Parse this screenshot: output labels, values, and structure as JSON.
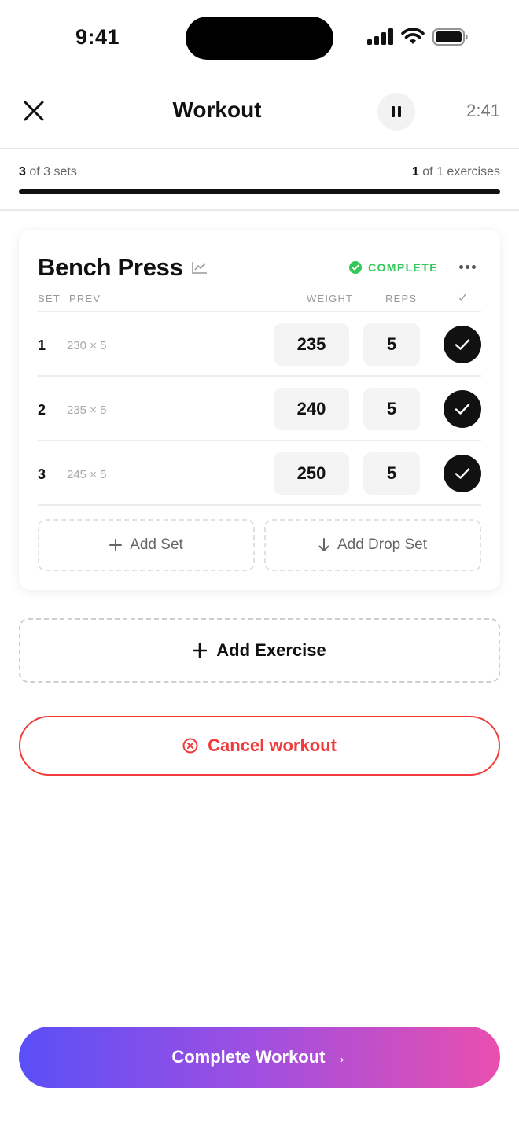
{
  "status_bar": {
    "time": "9:41"
  },
  "header": {
    "title": "Workout",
    "timer": "2:41"
  },
  "progress": {
    "sets_done": "3",
    "sets_text": "of 3 sets",
    "exercises_done": "1",
    "exercises_text": "of 1 exercises",
    "fraction": 1.0
  },
  "exercise": {
    "name": "Bench Press",
    "status": "COMPLETE",
    "columns": {
      "set": "SET",
      "prev": "PREV",
      "weight": "WEIGHT",
      "reps": "REPS",
      "done": "✓"
    },
    "sets": [
      {
        "num": "1",
        "prev": "230 × 5",
        "weight": "235",
        "reps": "5"
      },
      {
        "num": "2",
        "prev": "235 × 5",
        "weight": "240",
        "reps": "5"
      },
      {
        "num": "3",
        "prev": "245 × 5",
        "weight": "250",
        "reps": "5"
      }
    ],
    "add_set_label": "Add Set",
    "add_drop_set_label": "Add Drop Set"
  },
  "add_exercise_label": "Add Exercise",
  "cancel_label": "Cancel workout",
  "complete_label": "Complete Workout →",
  "colors": {
    "accent_green": "#34c759",
    "danger_red": "#ef3b3b",
    "gradient_start": "#5a4ff7",
    "gradient_end": "#e94fae"
  },
  "icons": {
    "close": "close-icon",
    "pause": "pause-icon",
    "chart": "chart-icon",
    "complete": "check-circle-icon",
    "more": "more-dots-icon",
    "check": "check-icon",
    "plus": "plus-icon",
    "arrow_down": "arrow-down-icon",
    "cancel": "x-circle-icon"
  }
}
